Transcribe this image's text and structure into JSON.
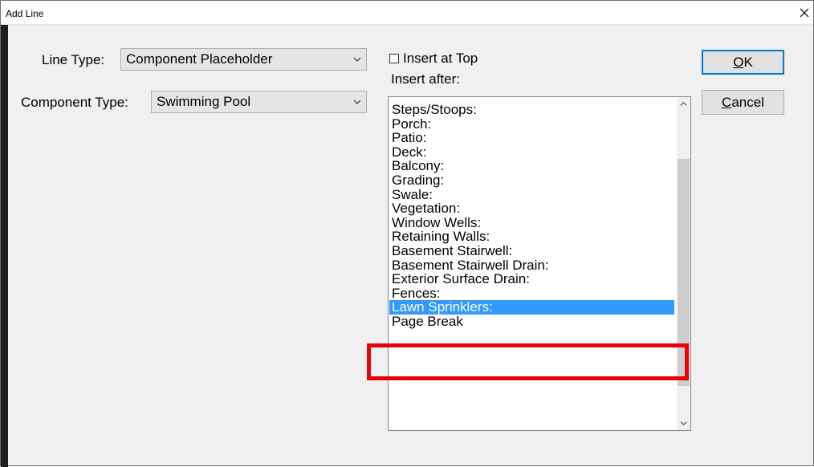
{
  "window": {
    "title": "Add Line",
    "close_glyph": "✕"
  },
  "form": {
    "line_type_label": "Line Type:",
    "line_type_value": "Component Placeholder",
    "component_type_label": "Component Type:",
    "component_type_value": "Swimming Pool"
  },
  "insert": {
    "insert_at_top_label": "Insert at Top",
    "insert_at_top_checked": false,
    "insert_after_label": "Insert after:"
  },
  "list": {
    "items": [
      "Steps/Stoops:",
      "Porch:",
      "Patio:",
      "Deck:",
      "Balcony:",
      "Grading:",
      "Swale:",
      "Vegetation:",
      "Window Wells:",
      "Retaining Walls:",
      "Basement Stairwell:",
      "Basement Stairwell Drain:",
      "Exterior Surface Drain:",
      "Fences:",
      "Lawn Sprinklers:",
      "Page Break"
    ],
    "selected_index": 14
  },
  "buttons": {
    "ok_label": "OK",
    "ok_mnemonic": "O",
    "cancel_label": "Cancel",
    "cancel_mnemonic": "C"
  },
  "colors": {
    "selection": "#3399ff",
    "highlight_box": "#e8000b",
    "default_button_border": "#0078d7"
  },
  "icons": {
    "combo_arrow": "chevron-down-icon",
    "scroll_up": "chevron-up-icon",
    "scroll_down": "chevron-down-icon",
    "close": "close-icon"
  }
}
